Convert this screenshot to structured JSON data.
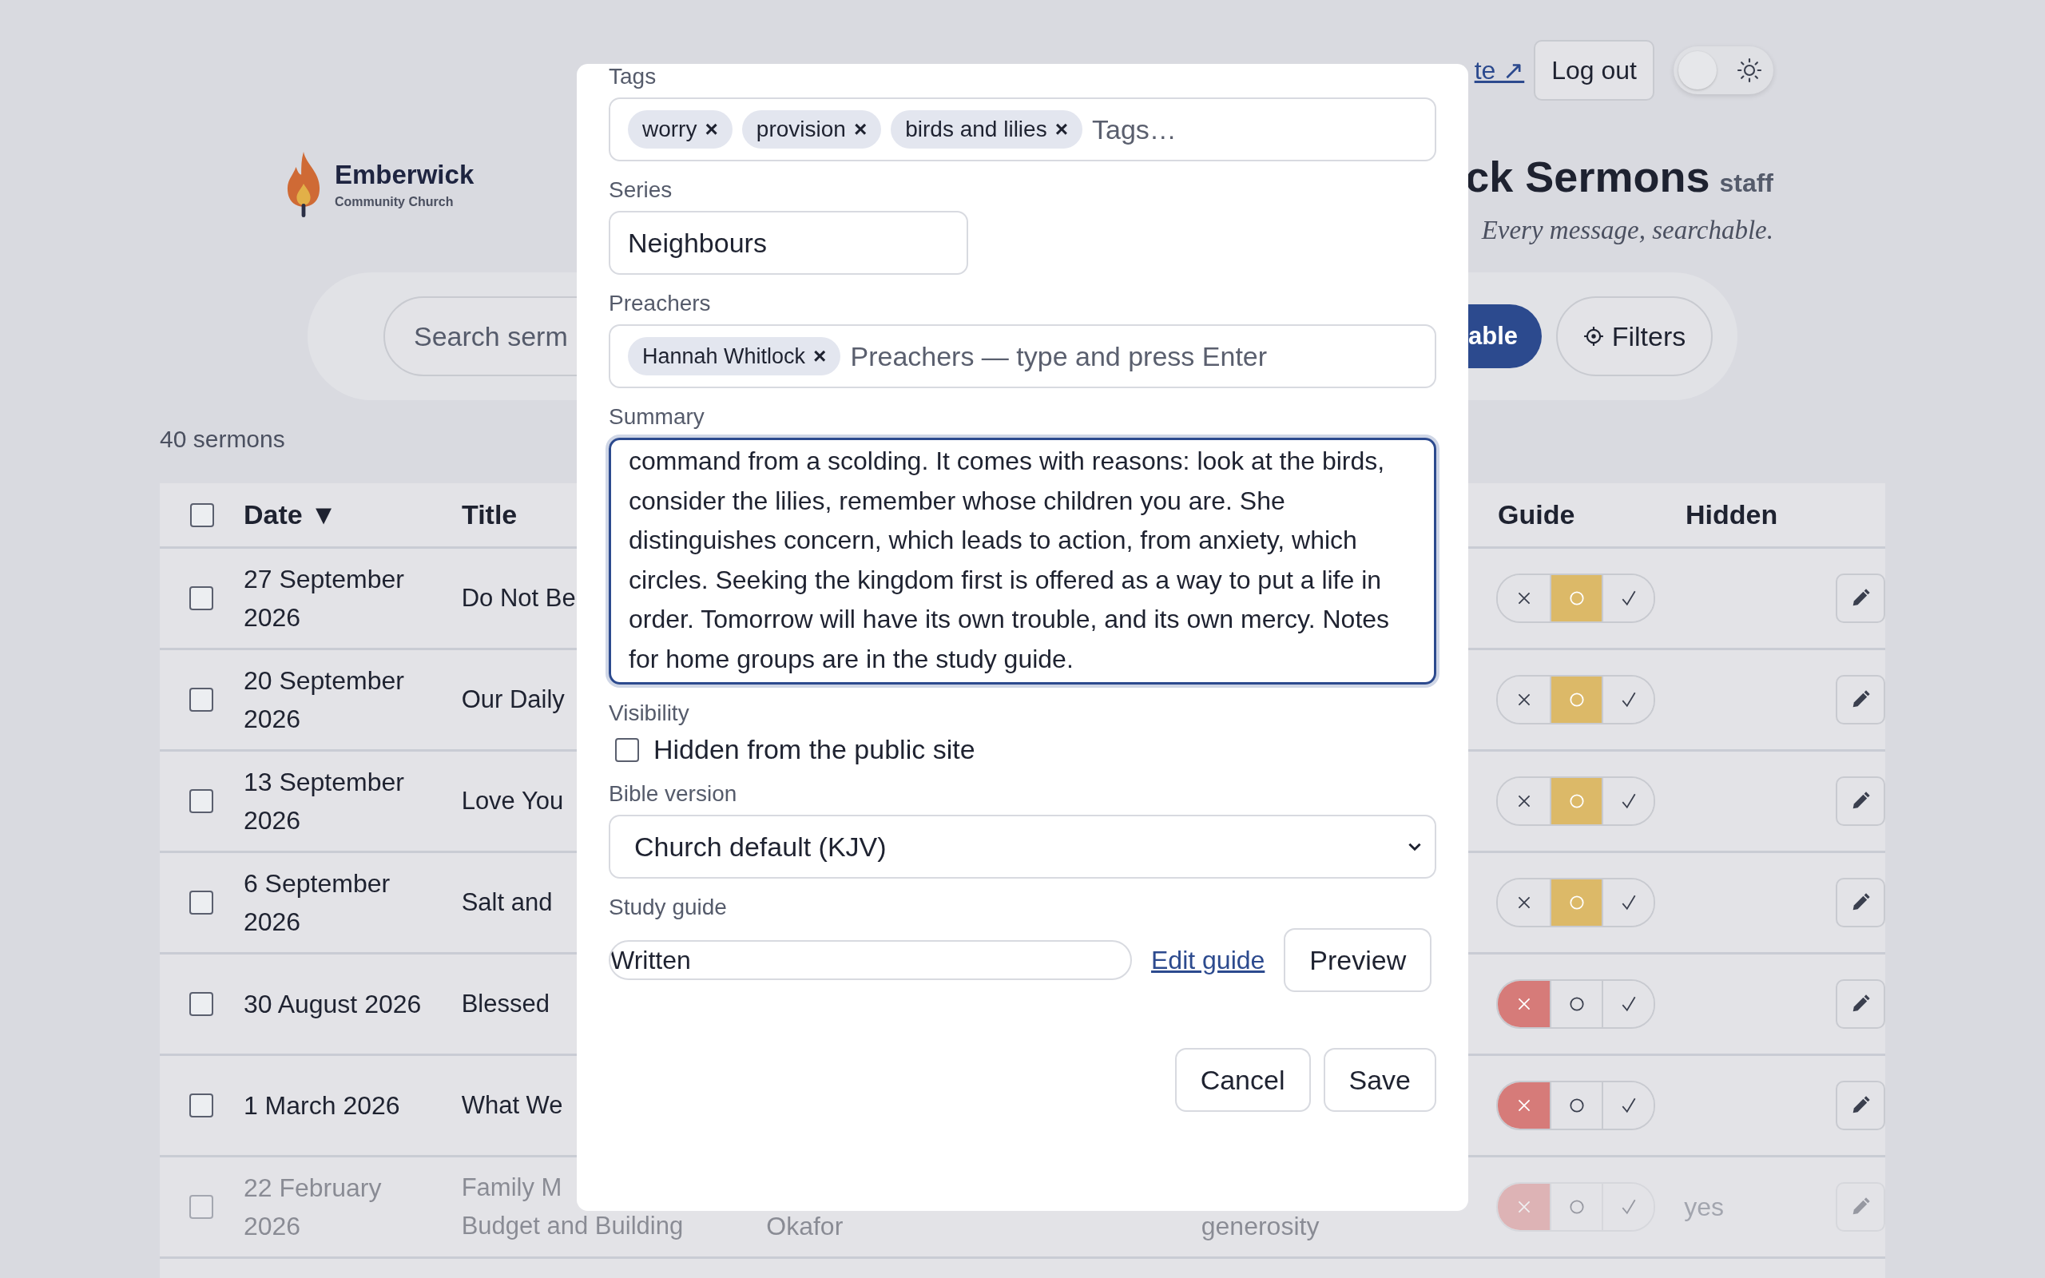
{
  "header": {
    "logo_name": "Emberwick",
    "logo_subtitle": "Community Church",
    "nav_link": "te ↗",
    "logout": "Log out",
    "theme_toggle": {
      "on": false
    },
    "title": "ck Sermons",
    "title_badge": "staff",
    "tagline": "Every message, searchable."
  },
  "search": {
    "placeholder": "Search serm",
    "view_button": "able",
    "filters_button": "Filters"
  },
  "count": "40 sermons",
  "table": {
    "select_all": {
      "checked": false
    },
    "columns": [
      {
        "label": "Date",
        "sort": "▼"
      },
      {
        "label": "Title"
      },
      {
        "label": "Guide"
      },
      {
        "label": "Hidden"
      }
    ],
    "rows": [
      {
        "checked": false,
        "date": "27 September 2026",
        "title": "Do Not Be",
        "guide": [
          {
            "kind": "no",
            "selected": false
          },
          {
            "kind": "pending",
            "selected": true
          },
          {
            "kind": "yes",
            "selected": false
          }
        ],
        "hidden": false
      },
      {
        "checked": false,
        "date": "20 September 2026",
        "title": "Our Daily",
        "guide": [
          {
            "kind": "no",
            "selected": false
          },
          {
            "kind": "pending",
            "selected": true
          },
          {
            "kind": "yes",
            "selected": false
          }
        ],
        "hidden": false
      },
      {
        "checked": false,
        "date": "13 September 2026",
        "title": "Love You",
        "guide": [
          {
            "kind": "no",
            "selected": false
          },
          {
            "kind": "pending",
            "selected": true
          },
          {
            "kind": "yes",
            "selected": false
          }
        ],
        "hidden": false
      },
      {
        "checked": false,
        "date": "6 September 2026",
        "title": "Salt and",
        "guide": [
          {
            "kind": "no",
            "selected": false
          },
          {
            "kind": "pending",
            "selected": true
          },
          {
            "kind": "yes",
            "selected": false
          }
        ],
        "hidden": false
      },
      {
        "checked": false,
        "date": "30 August 2026",
        "title": "Blessed",
        "guide": [
          {
            "kind": "no",
            "selected": true
          },
          {
            "kind": "pending",
            "selected": false
          },
          {
            "kind": "yes",
            "selected": false
          }
        ],
        "hidden": false
      },
      {
        "checked": false,
        "date": "1 March 2026",
        "title": "What We",
        "guide": [
          {
            "kind": "no",
            "selected": true
          },
          {
            "kind": "pending",
            "selected": false
          },
          {
            "kind": "yes",
            "selected": false
          }
        ],
        "hidden": false
      },
      {
        "checked": false,
        "date": "22 February 2026",
        "title": "Family M",
        "title_continued": "Budget and Building",
        "preacher": "Okafor",
        "tags": "generosity",
        "guide": [
          {
            "kind": "no",
            "selected": true
          },
          {
            "kind": "pending",
            "selected": false
          },
          {
            "kind": "yes",
            "selected": false
          }
        ],
        "hidden": true,
        "hidden_label": "yes"
      }
    ]
  },
  "modal": {
    "tags_label": "Tags",
    "tags": [
      {
        "label": "worry",
        "remove": "×"
      },
      {
        "label": "provision",
        "remove": "×"
      },
      {
        "label": "birds and lilies",
        "remove": "×"
      }
    ],
    "tags_placeholder": "Tags…",
    "series_label": "Series",
    "series_value": "Neighbours",
    "preachers_label": "Preachers",
    "preachers": [
      {
        "label": "Hannah Whitlock",
        "remove": "×"
      }
    ],
    "preachers_placeholder": "Preachers — type and press Enter",
    "summary_label": "Summary",
    "summary": "command from a scolding. It comes with reasons: look at the birds, consider the lilies, remember whose children you are. She distinguishes concern, which leads to action, from anxiety, which circles. Seeking the kingdom first is offered as a way to put a life in order. Tomorrow will have its own trouble, and its own mercy. Notes for home groups are in the study guide.",
    "visibility_label": "Visibility",
    "hidden_checkbox": {
      "label": "Hidden from the public site",
      "checked": false
    },
    "bible_label": "Bible version",
    "bible_value": "Church default (KJV)",
    "guide_label": "Study guide",
    "guide_value": "Written",
    "edit_guide": "Edit guide",
    "preview": "Preview",
    "cancel": "Cancel",
    "save": "Save"
  }
}
